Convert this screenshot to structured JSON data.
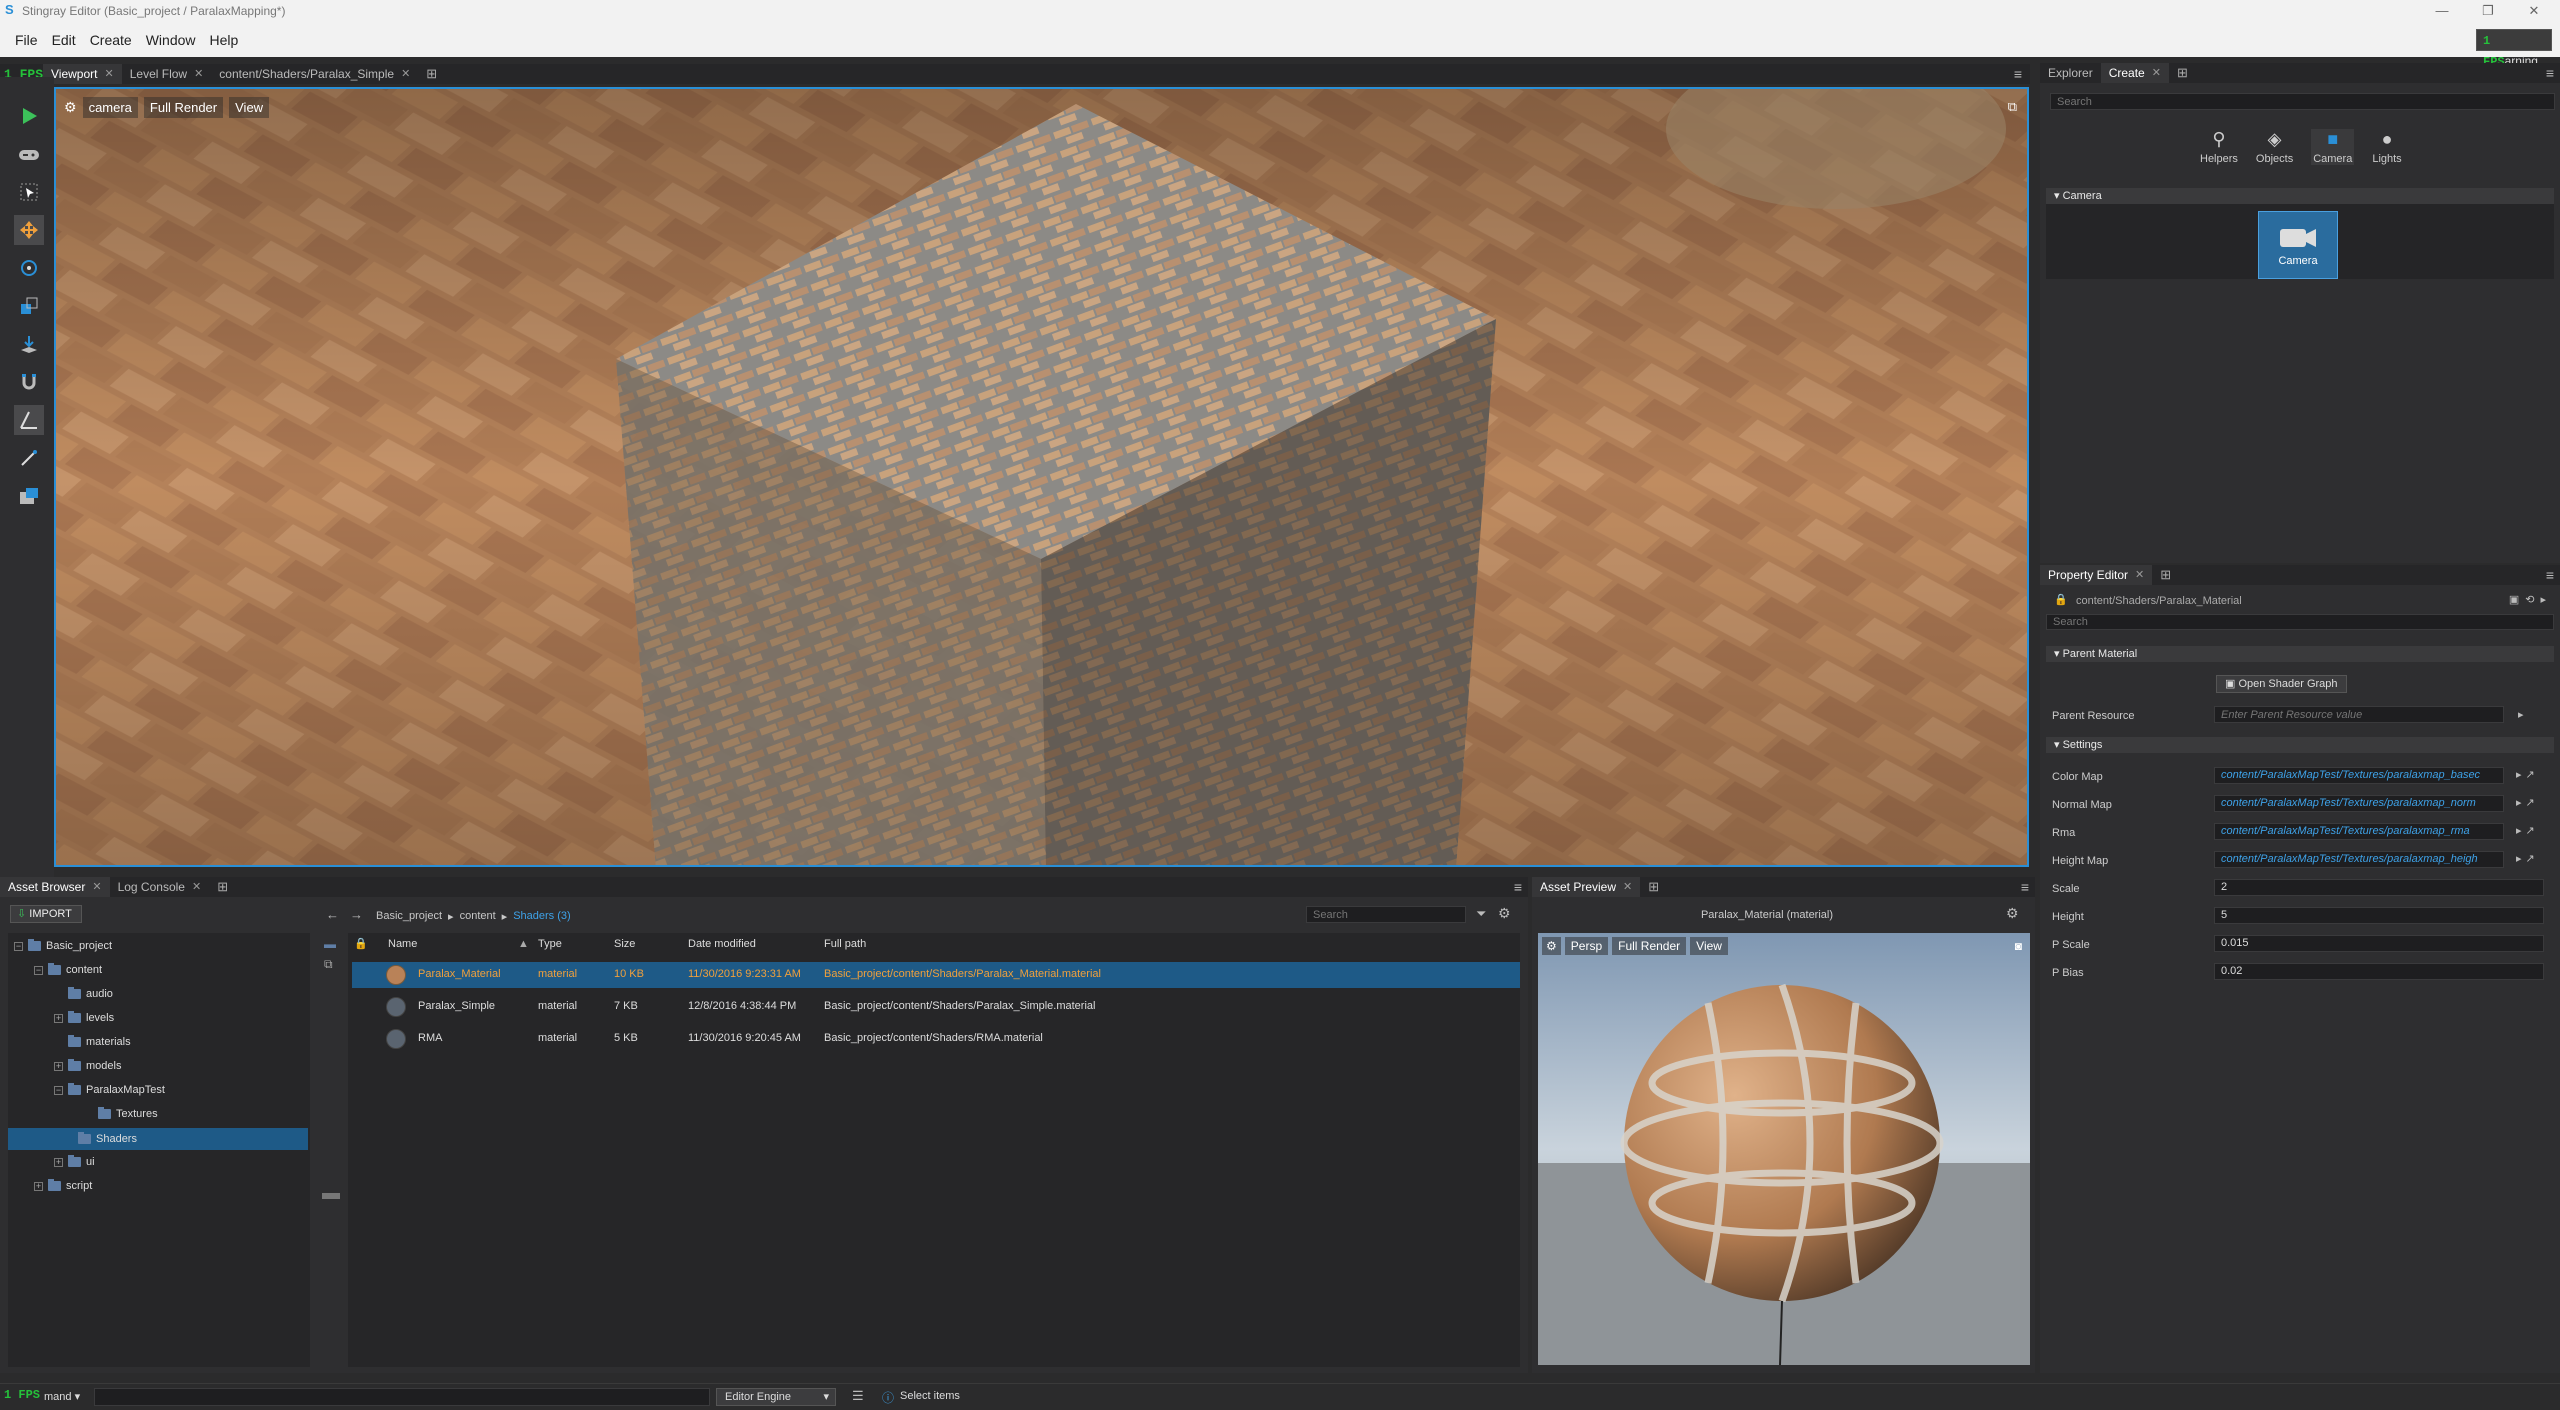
{
  "window": {
    "title": "Stingray Editor (Basic_project / ParalaxMapping*)",
    "controls": [
      "—",
      "❐",
      "✕"
    ]
  },
  "menubar": {
    "items": [
      "File",
      "Edit",
      "Create",
      "Window",
      "Help"
    ],
    "badge_fps": "1 FPS",
    "badge_text": "arning"
  },
  "viewport_tabs": {
    "tabs": [
      "Viewport",
      "Level Flow",
      "content/Shaders/Paralax_Simple"
    ]
  },
  "viewport": {
    "camera": "camera",
    "render": "Full Render",
    "view": "View",
    "fps": "1 FPS"
  },
  "explorer_tabs": {
    "tabs": [
      "Explorer",
      "Create"
    ]
  },
  "create": {
    "search_placeholder": "Search",
    "categories": [
      "Helpers",
      "Objects",
      "Camera",
      "Lights"
    ],
    "section": "Camera",
    "item": "Camera"
  },
  "property_editor": {
    "tab": "Property Editor",
    "path": "content/Shaders/Paralax_Material",
    "search_placeholder": "Search",
    "parent_section": "Parent Material",
    "open_shader_graph": "Open Shader Graph",
    "parent_resource_label": "Parent Resource",
    "parent_resource_placeholder": "Enter Parent Resource value",
    "settings_section": "Settings",
    "fields": [
      {
        "label": "Color Map",
        "value": "content/ParalaxMapTest/Textures/paralaxmap_basec"
      },
      {
        "label": "Normal Map",
        "value": "content/ParalaxMapTest/Textures/paralaxmap_norm"
      },
      {
        "label": "Rma",
        "value": "content/ParalaxMapTest/Textures/paralaxmap_rma"
      },
      {
        "label": "Height Map",
        "value": "content/ParalaxMapTest/Textures/paralaxmap_heigh"
      }
    ],
    "numbers": [
      {
        "label": "Scale",
        "value": "2"
      },
      {
        "label": "Height",
        "value": "5"
      },
      {
        "label": "P Scale",
        "value": "0.015"
      },
      {
        "label": "P Bias",
        "value": "0.02"
      }
    ]
  },
  "asset_browser": {
    "tabs": [
      "Asset Browser",
      "Log Console"
    ],
    "import": "IMPORT",
    "breadcrumb": [
      "Basic_project",
      "content",
      "Shaders (3)"
    ],
    "search_placeholder": "Search",
    "tree": [
      {
        "label": "Basic_project",
        "depth": 0
      },
      {
        "label": "content",
        "depth": 1
      },
      {
        "label": "audio",
        "depth": 2
      },
      {
        "label": "levels",
        "depth": 2
      },
      {
        "label": "materials",
        "depth": 2
      },
      {
        "label": "models",
        "depth": 2
      },
      {
        "label": "ParalaxMapTest",
        "depth": 2
      },
      {
        "label": "Textures",
        "depth": 3
      },
      {
        "label": "Shaders",
        "depth": 2
      },
      {
        "label": "ui",
        "depth": 2
      },
      {
        "label": "script",
        "depth": 1
      }
    ],
    "columns": [
      "Name",
      "Type",
      "Size",
      "Date modified",
      "Full path"
    ],
    "rows": [
      {
        "name": "Paralax_Material",
        "type": "material",
        "size": "10 KB",
        "date": "11/30/2016 9:23:31 AM",
        "path": "Basic_project/content/Shaders/Paralax_Material.material"
      },
      {
        "name": "Paralax_Simple",
        "type": "material",
        "size": "7 KB",
        "date": "12/8/2016 4:38:44 PM",
        "path": "Basic_project/content/Shaders/Paralax_Simple.material"
      },
      {
        "name": "RMA",
        "type": "material",
        "size": "5 KB",
        "date": "11/30/2016 9:20:45 AM",
        "path": "Basic_project/content/Shaders/RMA.material"
      }
    ]
  },
  "asset_preview": {
    "tab": "Asset Preview",
    "title": "Paralax_Material (material)",
    "persp": "Persp",
    "render": "Full Render",
    "view": "View"
  },
  "statusbar": {
    "fps": "1 FPS",
    "command": "mand",
    "engine": "Editor Engine",
    "status": "Select items"
  },
  "colors": {
    "accent": "#2a8fd6",
    "selection": "#1e5a87",
    "selected_text": "#f0a03c",
    "fps": "#25c13a"
  }
}
